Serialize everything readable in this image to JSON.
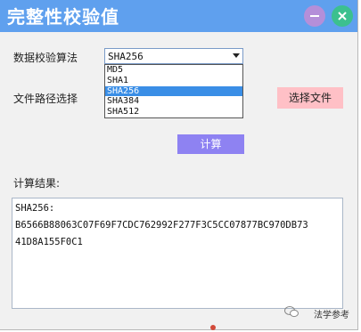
{
  "window": {
    "title": "完整性校验值",
    "colors": {
      "titlebar": "#5fa0ee",
      "minimize": "#b48fd9",
      "close": "#3cc08f"
    }
  },
  "form": {
    "algorithm_label": "数据校验算法",
    "path_label": "文件路径选择",
    "result_label": "计算结果:"
  },
  "select": {
    "value": "SHA256",
    "options": [
      "MD5",
      "SHA1",
      "SHA256",
      "SHA384",
      "SHA512"
    ],
    "highlighted": "SHA256"
  },
  "buttons": {
    "choose_file": "选择文件",
    "calculate": "计算",
    "colors": {
      "choose_file": "#ffc0c6",
      "calculate": "#8e82f2"
    }
  },
  "result": {
    "lines": [
      "SHA256:",
      "B6566B88063C07F69F7CDC762992F277F3C5CC07877BC970DB73",
      "41D8A155F0C1"
    ]
  },
  "watermark": {
    "text": "法学参考",
    "icon": "wechat-icon"
  }
}
